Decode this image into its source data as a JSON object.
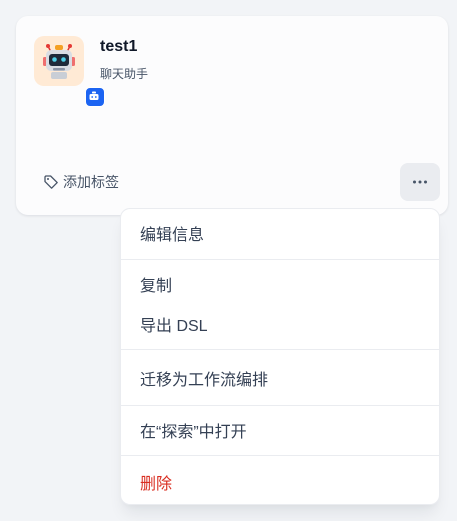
{
  "app": {
    "name": "test1",
    "mode_label": "聊天助手",
    "icon": "robot-emoji-icon",
    "icon_background": "#FFEAD5",
    "type_badge_icon": "chatbot-icon",
    "type_badge_color": "#1C64F2"
  },
  "tags": {
    "add_label": "添加标签",
    "icon": "tag-icon"
  },
  "more_button": {
    "icon": "more-horizontal-icon"
  },
  "menu": {
    "edit_info": "编辑信息",
    "duplicate": "复制",
    "export_dsl": "导出 DSL",
    "switch_to_workflow": "迁移为工作流编排",
    "open_in_explore": "在“探索”中打开",
    "delete": "删除",
    "delete_color": "#D92D20"
  }
}
